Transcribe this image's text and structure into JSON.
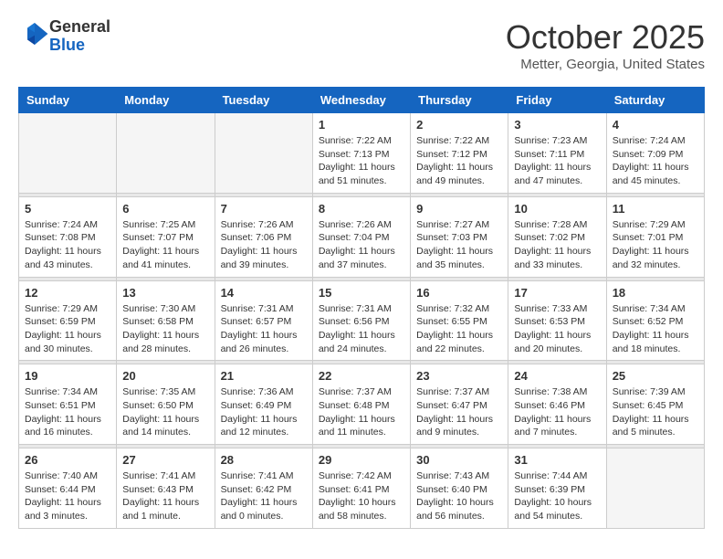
{
  "header": {
    "logo_general": "General",
    "logo_blue": "Blue",
    "month_title": "October 2025",
    "location": "Metter, Georgia, United States"
  },
  "weekdays": [
    "Sunday",
    "Monday",
    "Tuesday",
    "Wednesday",
    "Thursday",
    "Friday",
    "Saturday"
  ],
  "weeks": [
    [
      {
        "day": "",
        "info": ""
      },
      {
        "day": "",
        "info": ""
      },
      {
        "day": "",
        "info": ""
      },
      {
        "day": "1",
        "info": "Sunrise: 7:22 AM\nSunset: 7:13 PM\nDaylight: 11 hours and 51 minutes."
      },
      {
        "day": "2",
        "info": "Sunrise: 7:22 AM\nSunset: 7:12 PM\nDaylight: 11 hours and 49 minutes."
      },
      {
        "day": "3",
        "info": "Sunrise: 7:23 AM\nSunset: 7:11 PM\nDaylight: 11 hours and 47 minutes."
      },
      {
        "day": "4",
        "info": "Sunrise: 7:24 AM\nSunset: 7:09 PM\nDaylight: 11 hours and 45 minutes."
      }
    ],
    [
      {
        "day": "5",
        "info": "Sunrise: 7:24 AM\nSunset: 7:08 PM\nDaylight: 11 hours and 43 minutes."
      },
      {
        "day": "6",
        "info": "Sunrise: 7:25 AM\nSunset: 7:07 PM\nDaylight: 11 hours and 41 minutes."
      },
      {
        "day": "7",
        "info": "Sunrise: 7:26 AM\nSunset: 7:06 PM\nDaylight: 11 hours and 39 minutes."
      },
      {
        "day": "8",
        "info": "Sunrise: 7:26 AM\nSunset: 7:04 PM\nDaylight: 11 hours and 37 minutes."
      },
      {
        "day": "9",
        "info": "Sunrise: 7:27 AM\nSunset: 7:03 PM\nDaylight: 11 hours and 35 minutes."
      },
      {
        "day": "10",
        "info": "Sunrise: 7:28 AM\nSunset: 7:02 PM\nDaylight: 11 hours and 33 minutes."
      },
      {
        "day": "11",
        "info": "Sunrise: 7:29 AM\nSunset: 7:01 PM\nDaylight: 11 hours and 32 minutes."
      }
    ],
    [
      {
        "day": "12",
        "info": "Sunrise: 7:29 AM\nSunset: 6:59 PM\nDaylight: 11 hours and 30 minutes."
      },
      {
        "day": "13",
        "info": "Sunrise: 7:30 AM\nSunset: 6:58 PM\nDaylight: 11 hours and 28 minutes."
      },
      {
        "day": "14",
        "info": "Sunrise: 7:31 AM\nSunset: 6:57 PM\nDaylight: 11 hours and 26 minutes."
      },
      {
        "day": "15",
        "info": "Sunrise: 7:31 AM\nSunset: 6:56 PM\nDaylight: 11 hours and 24 minutes."
      },
      {
        "day": "16",
        "info": "Sunrise: 7:32 AM\nSunset: 6:55 PM\nDaylight: 11 hours and 22 minutes."
      },
      {
        "day": "17",
        "info": "Sunrise: 7:33 AM\nSunset: 6:53 PM\nDaylight: 11 hours and 20 minutes."
      },
      {
        "day": "18",
        "info": "Sunrise: 7:34 AM\nSunset: 6:52 PM\nDaylight: 11 hours and 18 minutes."
      }
    ],
    [
      {
        "day": "19",
        "info": "Sunrise: 7:34 AM\nSunset: 6:51 PM\nDaylight: 11 hours and 16 minutes."
      },
      {
        "day": "20",
        "info": "Sunrise: 7:35 AM\nSunset: 6:50 PM\nDaylight: 11 hours and 14 minutes."
      },
      {
        "day": "21",
        "info": "Sunrise: 7:36 AM\nSunset: 6:49 PM\nDaylight: 11 hours and 12 minutes."
      },
      {
        "day": "22",
        "info": "Sunrise: 7:37 AM\nSunset: 6:48 PM\nDaylight: 11 hours and 11 minutes."
      },
      {
        "day": "23",
        "info": "Sunrise: 7:37 AM\nSunset: 6:47 PM\nDaylight: 11 hours and 9 minutes."
      },
      {
        "day": "24",
        "info": "Sunrise: 7:38 AM\nSunset: 6:46 PM\nDaylight: 11 hours and 7 minutes."
      },
      {
        "day": "25",
        "info": "Sunrise: 7:39 AM\nSunset: 6:45 PM\nDaylight: 11 hours and 5 minutes."
      }
    ],
    [
      {
        "day": "26",
        "info": "Sunrise: 7:40 AM\nSunset: 6:44 PM\nDaylight: 11 hours and 3 minutes."
      },
      {
        "day": "27",
        "info": "Sunrise: 7:41 AM\nSunset: 6:43 PM\nDaylight: 11 hours and 1 minute."
      },
      {
        "day": "28",
        "info": "Sunrise: 7:41 AM\nSunset: 6:42 PM\nDaylight: 11 hours and 0 minutes."
      },
      {
        "day": "29",
        "info": "Sunrise: 7:42 AM\nSunset: 6:41 PM\nDaylight: 10 hours and 58 minutes."
      },
      {
        "day": "30",
        "info": "Sunrise: 7:43 AM\nSunset: 6:40 PM\nDaylight: 10 hours and 56 minutes."
      },
      {
        "day": "31",
        "info": "Sunrise: 7:44 AM\nSunset: 6:39 PM\nDaylight: 10 hours and 54 minutes."
      },
      {
        "day": "",
        "info": ""
      }
    ]
  ]
}
